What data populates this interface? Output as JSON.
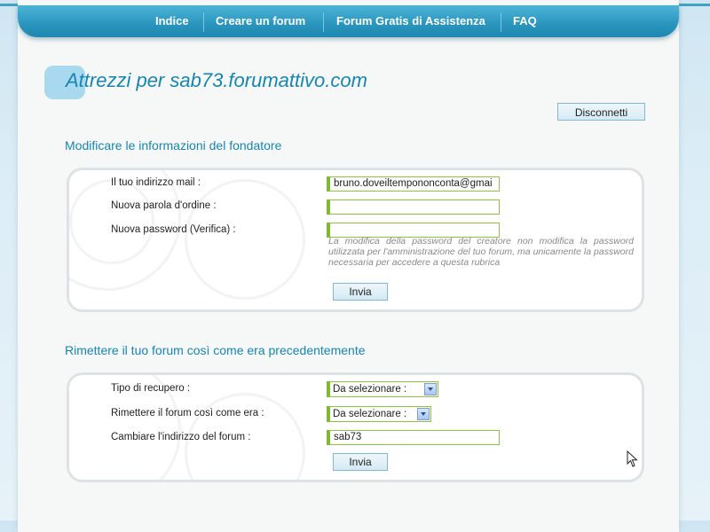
{
  "nav": {
    "items": [
      "Indice",
      "Creare un forum",
      "Forum Gratis di Assistenza",
      "FAQ"
    ]
  },
  "page_title": "Attrezzi per sab73.forumattivo.com",
  "disconnect_label": "Disconnetti",
  "founder_section": {
    "title": "Modificare le informazioni del fondatore",
    "email_label": "Il tuo indirizzo mail :",
    "email_value": "bruno.doveiltempononconta@gmai",
    "password_label": "Nuova parola d'ordine :",
    "password_value": "",
    "password_verify_label": "Nuova password (Verifica) :",
    "password_verify_value": "",
    "note": "La modifica della password del creatore non modifica la password utilizzata per l'amministrazione del tuo forum, ma unicamente la password necessaria per accedere a questa rubrica",
    "submit_label": "Invia"
  },
  "restore_section": {
    "title": "Rimettere il tuo forum così come era precedentemente",
    "recovery_type_label": "Tipo di recupero :",
    "recovery_type_value": "Da selezionare :",
    "restore_label": "Rimettere il forum così come era :",
    "restore_value": "Da selezionare :",
    "address_label": "Cambiare l'indirizzo del forum :",
    "address_value": "sab73",
    "submit_label": "Invia"
  },
  "colors": {
    "accent": "#1786b0",
    "nav_bg": "#2a95bd",
    "input_border": "#8cc63f",
    "note_text": "#8a8a8a"
  }
}
